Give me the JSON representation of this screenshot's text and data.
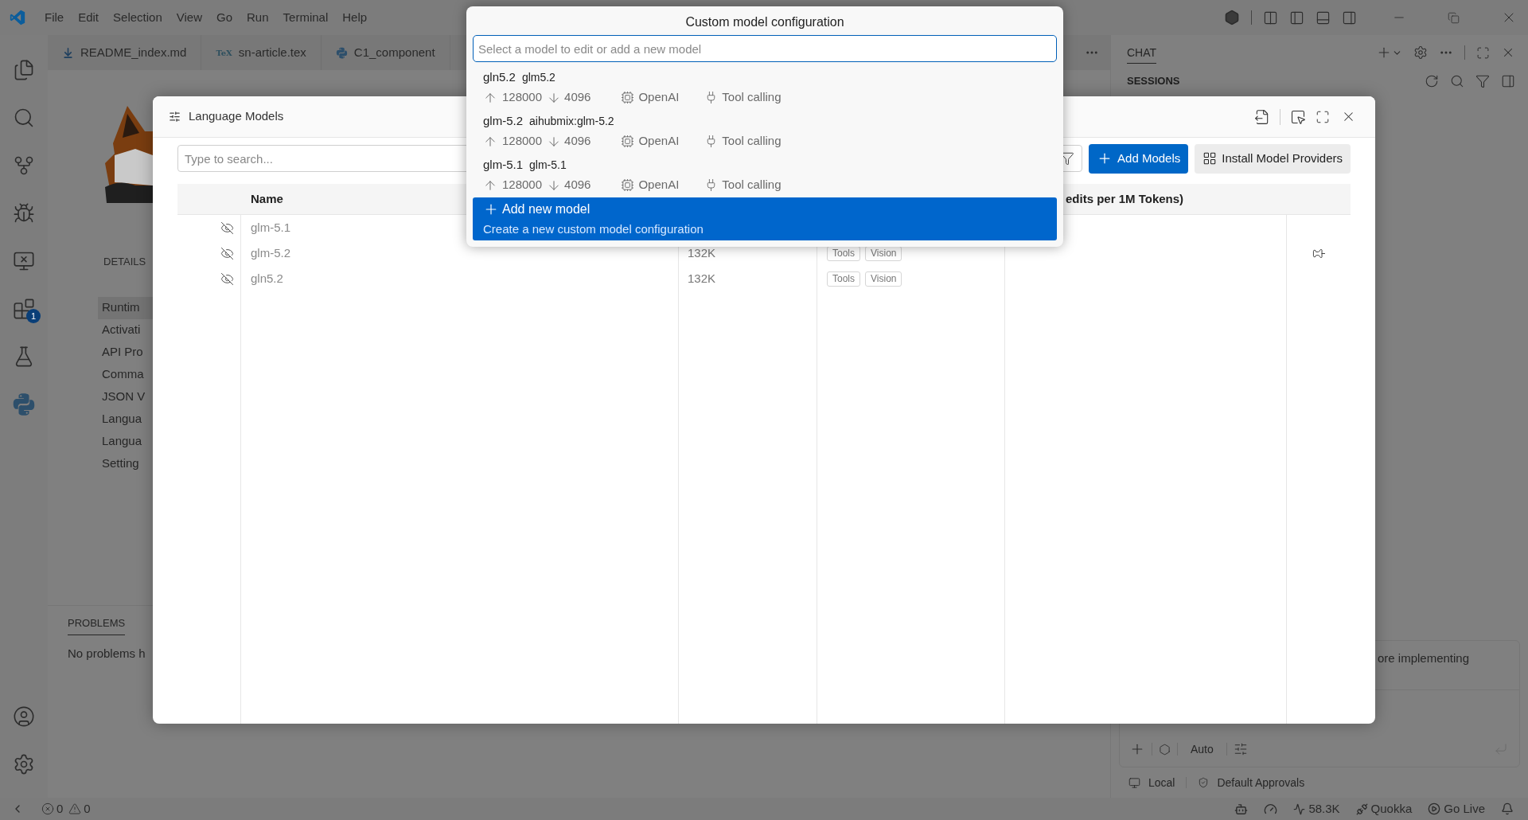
{
  "menu_bar": {
    "items": [
      "File",
      "Edit",
      "Selection",
      "View",
      "Go",
      "Run",
      "Terminal",
      "Help"
    ]
  },
  "activity_bar": {
    "extensions_badge": "1"
  },
  "editor_tabs": [
    {
      "label": "README_index.md",
      "kind": "markdown"
    },
    {
      "label": "sn-article.tex",
      "kind": "tex",
      "icon_text": "TeX"
    },
    {
      "label": "C1_component",
      "kind": "python"
    }
  ],
  "extension_page": {
    "section": "DETAILS",
    "nav": [
      {
        "label": "Runtim",
        "selected": true
      },
      {
        "label": "Activati",
        "selected": false
      },
      {
        "label": "API Pro",
        "selected": false
      },
      {
        "label": "Comma",
        "selected": false
      },
      {
        "label": "JSON V",
        "selected": false
      },
      {
        "label": "Langua",
        "selected": false
      },
      {
        "label": "Langua",
        "selected": false
      },
      {
        "label": "Setting",
        "selected": false
      }
    ]
  },
  "panel": {
    "tabs": [
      {
        "label": "PROBLEMS",
        "selected": true
      }
    ],
    "message": "No problems h"
  },
  "chat": {
    "tab": "CHAT",
    "sessions_heading": "SESSIONS",
    "message": "ore implementing",
    "mode": "Auto",
    "footer": [
      {
        "label": "Local",
        "kind": "environment"
      },
      {
        "label": "Default Approvals",
        "kind": "approvals"
      }
    ]
  },
  "status_bar": {
    "errors": "0",
    "warnings": "0",
    "items": [
      {
        "kind": "copilot"
      },
      {
        "kind": "accounts"
      },
      {
        "kind": "activity",
        "label": "58.3K"
      },
      {
        "kind": "quokka",
        "label": "Quokka"
      },
      {
        "kind": "golive",
        "label": "Go Live"
      },
      {
        "kind": "notifications"
      }
    ]
  },
  "language_models": {
    "title": "Language Models",
    "search": {
      "placeholder": "Type to search..."
    },
    "buttons": [
      {
        "label": "Add Models",
        "kind": "primary"
      },
      {
        "label": "Install Model Providers",
        "kind": "secondary"
      }
    ],
    "header": {
      "name": "Name",
      "cost": "edits per 1M Tokens)"
    },
    "rows": [
      {
        "name": "glm-5.1",
        "shown": false,
        "pinned": false
      },
      {
        "name": "glm-5.2",
        "shown": false,
        "context": "132K",
        "capabilities": [
          "Tools",
          "Vision"
        ],
        "pinned": true
      },
      {
        "name": "gln5.2",
        "shown": false,
        "context": "132K",
        "capabilities": [
          "Tools",
          "Vision"
        ],
        "pinned": false
      }
    ]
  },
  "quick_pick": {
    "title": "Custom model configuration",
    "placeholder": "Select a model to edit or add a new model",
    "items": [
      {
        "label": "gln5.2",
        "description": "glm5.2",
        "input_tokens": "128000",
        "output_tokens": "4096",
        "provider": "OpenAI",
        "capability": "Tool calling",
        "selected": false
      },
      {
        "label": "glm-5.2",
        "description": "aihubmix:glm-5.2",
        "input_tokens": "128000",
        "output_tokens": "4096",
        "provider": "OpenAI",
        "capability": "Tool calling",
        "selected": false
      },
      {
        "label": "glm-5.1",
        "description": "glm-5.1",
        "input_tokens": "128000",
        "output_tokens": "4096",
        "provider": "OpenAI",
        "capability": "Tool calling",
        "selected": false
      }
    ],
    "action": {
      "label": "Add new model",
      "detail": "Create a new custom model configuration",
      "selected": true
    }
  }
}
